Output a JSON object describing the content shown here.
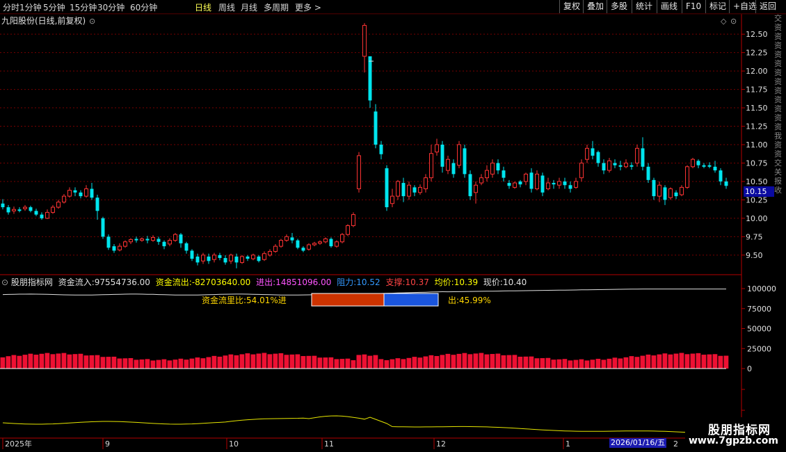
{
  "toolbar": {
    "periods": [
      "分时",
      "1分钟",
      "5分钟",
      "15分钟",
      "30分钟",
      "60分钟",
      "日线",
      "周线",
      "月线",
      "多周期",
      "更多 >"
    ],
    "active_period": "日线",
    "right_buttons": [
      "复权",
      "叠加",
      "多股",
      "统计",
      "画线",
      "F10",
      "标记",
      "+自选",
      "返回"
    ]
  },
  "main": {
    "title": "九阳股份(日线,前复权)",
    "current_price_tag": "10.15",
    "y_axis": [
      "12.50",
      "12.25",
      "12.00",
      "11.75",
      "11.50",
      "11.25",
      "11.00",
      "10.75",
      "10.50",
      "10.25",
      "10.00",
      "9.75",
      "9.50"
    ]
  },
  "indicator": {
    "name": "股朋指标网",
    "inflow_label": "资金流入:",
    "inflow_value": "97554736.00",
    "outflow_label": "资金流出:",
    "outflow_value": "-82703640.00",
    "net_label": "进出:",
    "net_value": "14851096.00",
    "resist_label": "阻力:",
    "resist_value": "10.52",
    "support_label": "支撑:",
    "support_value": "10.37",
    "avg_label": "均价:",
    "avg_value": "10.39",
    "now_label": "现价:",
    "now_value": "10.40",
    "ratio_in": "资金流里比:54.01%进",
    "ratio_out": "出:45.99%",
    "y_axis": [
      "100000",
      "75000",
      "50000",
      "25000",
      "0"
    ]
  },
  "x_axis": {
    "labels": [
      "2025年",
      "9",
      "10",
      "11",
      "12",
      "1"
    ],
    "cursor_date": "2026/01/16/五",
    "trailing": "2"
  },
  "watermark": {
    "title": "股朋指标网",
    "url": "www.7gpzb.com"
  },
  "colors": {
    "up": "#ff3333",
    "down": "#00e5ee",
    "grid": "#7a0000",
    "axis": "#b30000",
    "line": "#e0e0e0"
  },
  "chart_data": {
    "type": "candlestick",
    "ylim": [
      9.3,
      12.7
    ],
    "candles": [
      [
        10.2,
        10.15,
        10.26,
        10.12
      ],
      [
        10.15,
        10.08,
        10.18,
        10.05
      ],
      [
        10.1,
        10.12,
        10.16,
        10.06
      ],
      [
        10.12,
        10.1,
        10.15,
        10.08
      ],
      [
        10.13,
        10.15,
        10.18,
        10.1
      ],
      [
        10.15,
        10.1,
        10.17,
        10.08
      ],
      [
        10.1,
        10.05,
        10.13,
        10.03
      ],
      [
        10.05,
        10.0,
        10.08,
        9.98
      ],
      [
        10.0,
        10.08,
        10.12,
        9.99
      ],
      [
        10.08,
        10.15,
        10.18,
        10.06
      ],
      [
        10.15,
        10.22,
        10.25,
        10.13
      ],
      [
        10.22,
        10.3,
        10.33,
        10.2
      ],
      [
        10.3,
        10.38,
        10.42,
        10.28
      ],
      [
        10.38,
        10.35,
        10.42,
        10.3
      ],
      [
        10.35,
        10.3,
        10.38,
        10.27
      ],
      [
        10.3,
        10.4,
        10.45,
        10.28
      ],
      [
        10.4,
        10.28,
        10.48,
        10.25
      ],
      [
        10.28,
        10.1,
        10.32,
        9.98
      ],
      [
        10.0,
        9.75,
        10.02,
        9.72
      ],
      [
        9.75,
        9.6,
        9.78,
        9.57
      ],
      [
        9.62,
        9.56,
        9.65,
        9.53
      ],
      [
        9.57,
        9.62,
        9.66,
        9.55
      ],
      [
        9.62,
        9.68,
        9.7,
        9.6
      ],
      [
        9.68,
        9.71,
        9.73,
        9.65
      ],
      [
        9.72,
        9.7,
        9.75,
        9.67
      ],
      [
        9.7,
        9.72,
        9.74,
        9.68
      ],
      [
        9.72,
        9.7,
        9.76,
        9.66
      ],
      [
        9.7,
        9.74,
        9.77,
        9.68
      ],
      [
        9.72,
        9.68,
        9.75,
        9.64
      ],
      [
        9.68,
        9.62,
        9.7,
        9.58
      ],
      [
        9.65,
        9.7,
        9.73,
        9.62
      ],
      [
        9.7,
        9.78,
        9.8,
        9.68
      ],
      [
        9.78,
        9.66,
        9.8,
        9.6
      ],
      [
        9.66,
        9.56,
        9.68,
        9.52
      ],
      [
        9.56,
        9.45,
        9.58,
        9.42
      ],
      [
        9.48,
        9.4,
        9.52,
        9.36
      ],
      [
        9.42,
        9.5,
        9.53,
        9.38
      ],
      [
        9.48,
        9.42,
        9.52,
        9.38
      ],
      [
        9.44,
        9.5,
        9.53,
        9.4
      ],
      [
        9.5,
        9.46,
        9.53,
        9.43
      ],
      [
        9.46,
        9.4,
        9.5,
        9.37
      ],
      [
        9.42,
        9.5,
        9.52,
        9.38
      ],
      [
        9.48,
        9.4,
        9.52,
        9.32
      ],
      [
        9.4,
        9.48,
        9.5,
        9.38
      ],
      [
        9.48,
        9.45,
        9.5,
        9.42
      ],
      [
        9.45,
        9.5,
        9.52,
        9.43
      ],
      [
        9.48,
        9.42,
        9.5,
        9.4
      ],
      [
        9.44,
        9.52,
        9.55,
        9.42
      ],
      [
        9.5,
        9.55,
        9.58,
        9.48
      ],
      [
        9.55,
        9.62,
        9.65,
        9.53
      ],
      [
        9.62,
        9.7,
        9.72,
        9.6
      ],
      [
        9.7,
        9.75,
        9.78,
        9.68
      ],
      [
        9.74,
        9.7,
        9.8,
        9.66
      ],
      [
        9.7,
        9.6,
        9.72,
        9.58
      ],
      [
        9.6,
        9.56,
        9.62,
        9.54
      ],
      [
        9.58,
        9.64,
        9.66,
        9.56
      ],
      [
        9.64,
        9.66,
        9.68,
        9.62
      ],
      [
        9.66,
        9.68,
        9.7,
        9.64
      ],
      [
        9.68,
        9.72,
        9.74,
        9.66
      ],
      [
        9.72,
        9.62,
        9.74,
        9.6
      ],
      [
        9.62,
        9.68,
        9.7,
        9.6
      ],
      [
        9.68,
        9.78,
        9.8,
        9.66
      ],
      [
        9.78,
        9.9,
        9.92,
        9.76
      ],
      [
        9.9,
        10.05,
        10.08,
        9.88
      ],
      [
        10.4,
        10.85,
        10.9,
        10.35
      ],
      [
        12.2,
        12.62,
        12.65,
        11.98
      ],
      [
        12.2,
        11.6,
        12.2,
        11.5
      ],
      [
        11.45,
        11.0,
        11.55,
        10.95
      ],
      [
        11.0,
        10.87,
        11.05,
        10.8
      ],
      [
        10.68,
        10.15,
        10.72,
        10.1
      ],
      [
        10.2,
        10.3,
        10.4,
        10.15
      ],
      [
        10.3,
        10.5,
        10.52,
        10.25
      ],
      [
        10.48,
        10.3,
        10.55,
        10.22
      ],
      [
        10.3,
        10.45,
        10.5,
        10.25
      ],
      [
        10.42,
        10.35,
        10.45,
        10.3
      ],
      [
        10.35,
        10.42,
        10.46,
        10.32
      ],
      [
        10.4,
        10.55,
        10.6,
        10.35
      ],
      [
        10.55,
        10.88,
        11.0,
        10.5
      ],
      [
        10.9,
        11.0,
        11.08,
        10.85
      ],
      [
        11.0,
        10.7,
        11.05,
        10.62
      ],
      [
        10.65,
        10.8,
        10.85,
        10.6
      ],
      [
        10.75,
        10.6,
        10.8,
        10.55
      ],
      [
        10.72,
        11.0,
        11.05,
        10.68
      ],
      [
        10.95,
        10.6,
        11.0,
        10.55
      ],
      [
        10.6,
        10.3,
        10.65,
        10.25
      ],
      [
        10.35,
        10.45,
        10.5,
        10.2
      ],
      [
        10.48,
        10.55,
        10.6,
        10.45
      ],
      [
        10.55,
        10.65,
        10.72,
        10.5
      ],
      [
        10.6,
        10.75,
        10.8,
        10.55
      ],
      [
        10.75,
        10.65,
        10.8,
        10.6
      ],
      [
        10.65,
        10.55,
        10.7,
        10.5
      ],
      [
        10.48,
        10.44,
        10.52,
        10.4
      ],
      [
        10.42,
        10.48,
        10.5,
        10.4
      ],
      [
        10.5,
        10.46,
        10.52,
        10.42
      ],
      [
        10.5,
        10.6,
        10.62,
        10.45
      ],
      [
        10.62,
        10.4,
        10.68,
        10.35
      ],
      [
        10.4,
        10.6,
        10.65,
        10.38
      ],
      [
        10.58,
        10.35,
        10.62,
        10.3
      ],
      [
        10.4,
        10.48,
        10.55,
        10.38
      ],
      [
        10.48,
        10.46,
        10.52,
        10.4
      ],
      [
        10.45,
        10.5,
        10.55,
        10.4
      ],
      [
        10.5,
        10.45,
        10.55,
        10.4
      ],
      [
        10.45,
        10.4,
        10.5,
        10.35
      ],
      [
        10.42,
        10.5,
        10.55,
        10.4
      ],
      [
        10.55,
        10.75,
        10.8,
        10.5
      ],
      [
        10.8,
        10.95,
        11.0,
        10.75
      ],
      [
        10.95,
        10.85,
        11.05,
        10.8
      ],
      [
        10.9,
        10.75,
        10.92,
        10.7
      ],
      [
        10.75,
        10.65,
        10.8,
        10.6
      ],
      [
        10.65,
        10.78,
        10.82,
        10.62
      ],
      [
        10.75,
        10.72,
        10.8,
        10.68
      ],
      [
        10.72,
        10.7,
        10.78,
        10.65
      ],
      [
        10.7,
        10.75,
        10.8,
        10.68
      ],
      [
        10.72,
        10.7,
        10.76,
        10.66
      ],
      [
        10.75,
        10.95,
        11.0,
        10.7
      ],
      [
        10.95,
        10.7,
        11.1,
        10.65
      ],
      [
        10.7,
        10.52,
        10.75,
        10.48
      ],
      [
        10.52,
        10.3,
        10.55,
        10.25
      ],
      [
        10.3,
        10.45,
        10.5,
        10.22
      ],
      [
        10.42,
        10.25,
        10.45,
        10.18
      ],
      [
        10.28,
        10.4,
        10.42,
        10.25
      ],
      [
        10.35,
        10.3,
        10.38,
        10.26
      ],
      [
        10.32,
        10.42,
        10.45,
        10.3
      ],
      [
        10.42,
        10.7,
        10.72,
        10.4
      ],
      [
        10.7,
        10.8,
        10.82,
        10.68
      ],
      [
        10.78,
        10.72,
        10.8,
        10.68
      ],
      [
        10.72,
        10.7,
        10.75,
        10.68
      ],
      [
        10.72,
        10.7,
        10.76,
        10.68
      ],
      [
        10.7,
        10.65,
        10.78,
        10.62
      ],
      [
        10.65,
        10.5,
        10.68,
        10.45
      ],
      [
        10.5,
        10.44,
        10.55,
        10.4
      ]
    ]
  }
}
